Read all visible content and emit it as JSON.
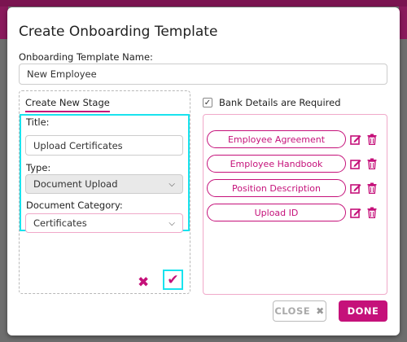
{
  "modal": {
    "title": "Create Onboarding Template",
    "template_name": {
      "label": "Onboarding Template Name:",
      "value": "New Employee"
    }
  },
  "stage": {
    "heading": "Create New Stage",
    "title_label": "Title:",
    "title_value": "Upload Certificates",
    "type_label": "Type:",
    "type_value": "Document Upload",
    "category_label": "Document Category:",
    "category_value": "Certificates"
  },
  "bank_details": {
    "label": "Bank Details are Required",
    "checked": true
  },
  "documents": [
    {
      "label": "Employee Agreement"
    },
    {
      "label": "Employee Handbook"
    },
    {
      "label": "Position Description"
    },
    {
      "label": "Upload ID"
    }
  ],
  "footer": {
    "close_label": "CLOSE",
    "done_label": "DONE"
  },
  "colors": {
    "accent": "#c5117a",
    "highlight": "#19e3ee"
  }
}
